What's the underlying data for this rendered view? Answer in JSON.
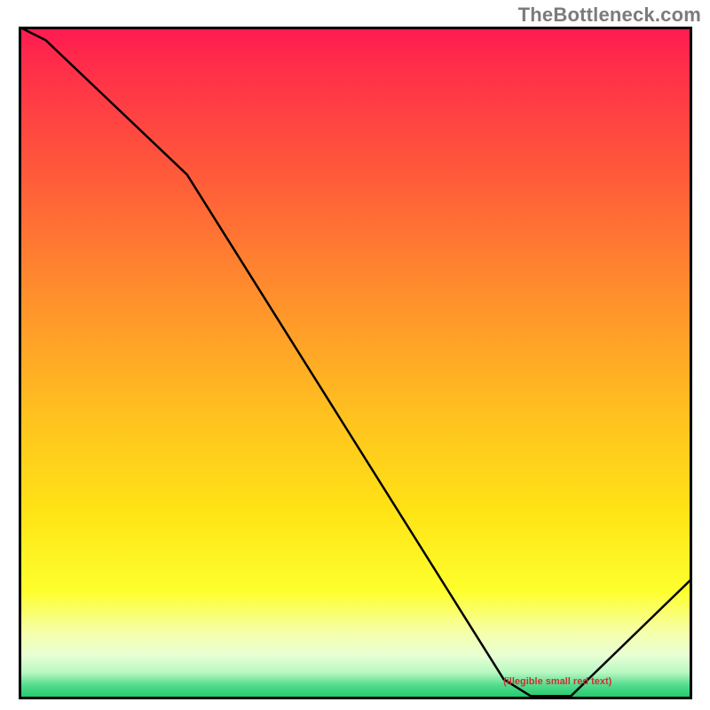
{
  "watermark": "TheBottleneck.com",
  "chart_data": {
    "type": "line",
    "title": "",
    "xlabel": "",
    "ylabel": "",
    "xlim": [
      0,
      100
    ],
    "ylim": [
      0,
      100
    ],
    "grid": false,
    "legend": false,
    "annotations": [
      {
        "text": "(illegible small red text)",
        "x": 80,
        "y": 2,
        "color": "#c83232"
      }
    ],
    "x": [
      0,
      4,
      25,
      72,
      76,
      82,
      100
    ],
    "values": [
      100,
      98,
      78,
      3,
      0.5,
      0.5,
      18
    ],
    "background_gradient": {
      "stops": [
        {
          "pos": 0.0,
          "color": "#ff1a52"
        },
        {
          "pos": 0.05,
          "color": "#ff2b4a"
        },
        {
          "pos": 0.22,
          "color": "#ff5a3a"
        },
        {
          "pos": 0.4,
          "color": "#ff8f2c"
        },
        {
          "pos": 0.58,
          "color": "#ffc21f"
        },
        {
          "pos": 0.72,
          "color": "#ffe315"
        },
        {
          "pos": 0.84,
          "color": "#feff2e"
        },
        {
          "pos": 0.9,
          "color": "#f6ffaa"
        },
        {
          "pos": 0.935,
          "color": "#e7ffd4"
        },
        {
          "pos": 0.96,
          "color": "#b8f8c2"
        },
        {
          "pos": 0.978,
          "color": "#57dd8e"
        },
        {
          "pos": 1.0,
          "color": "#18c667"
        }
      ]
    },
    "line_style": {
      "stroke": "#000000",
      "width": 2.5
    }
  }
}
